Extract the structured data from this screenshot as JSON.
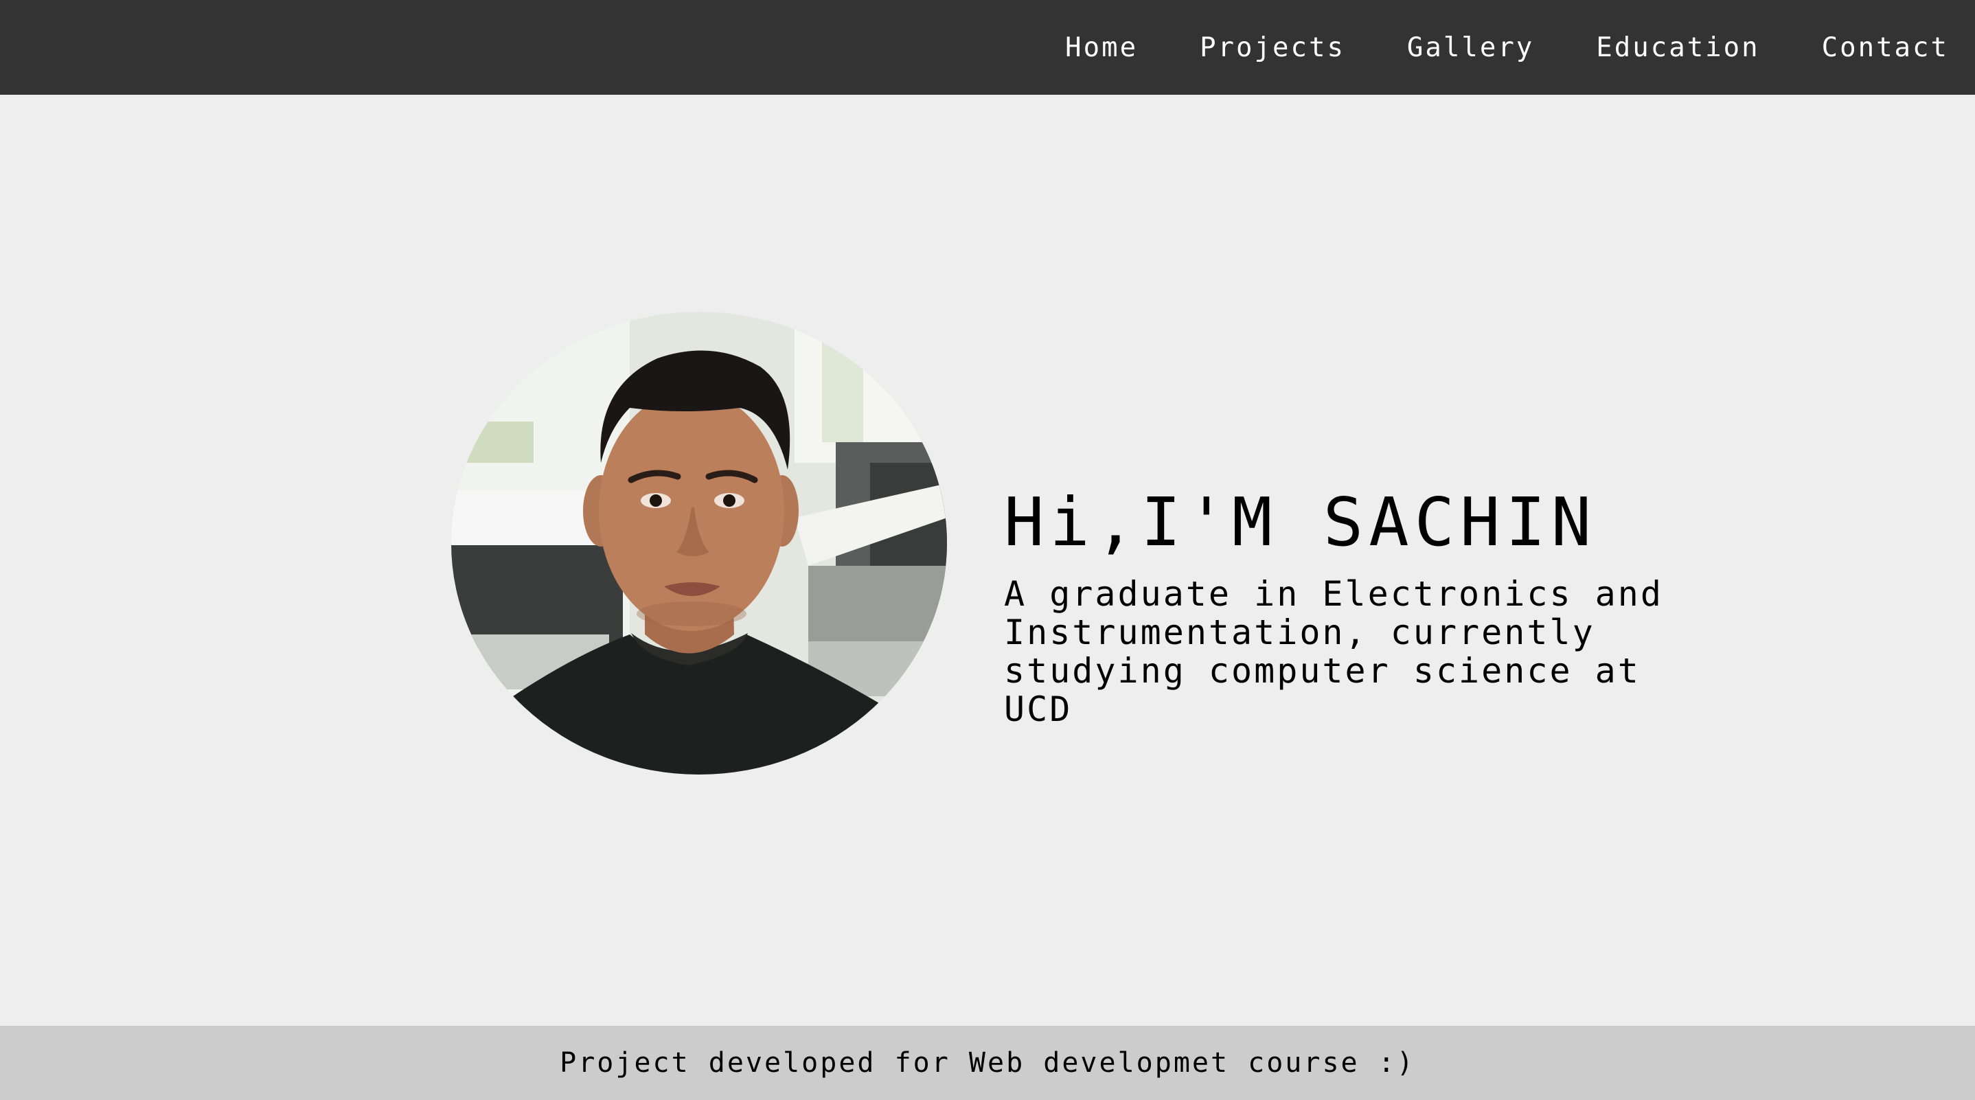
{
  "nav": {
    "items": [
      {
        "label": "Home"
      },
      {
        "label": "Projects"
      },
      {
        "label": "Gallery"
      },
      {
        "label": "Education"
      },
      {
        "label": "Contact"
      }
    ]
  },
  "hero": {
    "title": "Hi,I'M SACHIN",
    "subtitle": "A graduate in Electronics and Instrumentation, currently studying computer science at UCD"
  },
  "footer": {
    "text": "Project developed for Web developmet course :)"
  },
  "colors": {
    "navbar_bg": "#333333",
    "page_bg": "#eeeeee",
    "footer_bg": "#cccccc",
    "nav_text": "#ffffff",
    "body_text": "#000000"
  }
}
